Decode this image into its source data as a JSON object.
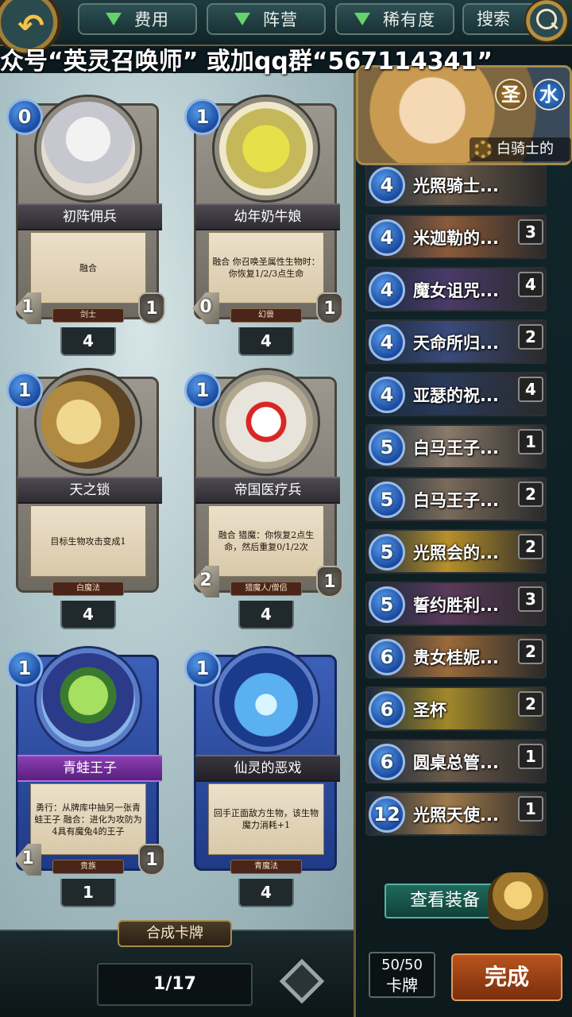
{
  "topbar": {
    "filters": [
      {
        "label": "费用"
      },
      {
        "label": "阵营"
      },
      {
        "label": "稀有度"
      }
    ],
    "search_label": "搜索"
  },
  "watermark": "众号“英灵召唤师” 或加qq群“567114341”",
  "cards": [
    {
      "name": "初阵佣兵",
      "cost": "0",
      "desc": "融合",
      "atk": "1",
      "hp": "1",
      "type": "剑士",
      "owned": "4",
      "style": "grey",
      "portrait": "pf-1"
    },
    {
      "name": "幼年奶牛娘",
      "cost": "1",
      "desc": "融合\n你召唤圣属性生物时：你恢复1/2/3点生命",
      "atk": "0",
      "hp": "1",
      "type": "幻兽",
      "owned": "4",
      "style": "grey",
      "portrait": "pf-2"
    },
    {
      "name": "天之锁",
      "cost": "1",
      "desc": "目标生物攻击变成1",
      "atk": "",
      "hp": "",
      "type": "白魔法",
      "owned": "4",
      "style": "grey",
      "portrait": "pf-3"
    },
    {
      "name": "帝国医疗兵",
      "cost": "1",
      "desc": "融合\n猎魔：你恢复2点生命，然后重复0/1/2次",
      "atk": "2",
      "hp": "1",
      "type": "猎魔人/僧侣",
      "owned": "4",
      "style": "grey",
      "portrait": "pf-4"
    },
    {
      "name": "青蛙王子",
      "cost": "1",
      "desc": "勇行：从牌库中抽另一张青蛙王子\n融合：进化为攻防为4具有魔兔4的王子",
      "atk": "1",
      "hp": "1",
      "type": "贵族",
      "owned": "1",
      "style": "blue purple",
      "portrait": "pf-5"
    },
    {
      "name": "仙灵的恶戏",
      "cost": "1",
      "desc": "回手正面敌方生物，该生物魔力消耗+1",
      "atk": "",
      "hp": "",
      "type": "青魔法",
      "owned": "4",
      "style": "blue blue2",
      "portrait": "pf-6"
    }
  ],
  "pager": {
    "merge_label": "合成卡牌",
    "page": "1/17"
  },
  "deck_hero": {
    "elements": [
      "圣",
      "水"
    ],
    "label": "白骑士的"
  },
  "deck": [
    {
      "cost": "4",
      "name": "光照骑士...",
      "count": "",
      "art": "#6a5a4a"
    },
    {
      "cost": "4",
      "name": "米迦勒的...",
      "count": "3",
      "art": "#8a5a3a"
    },
    {
      "cost": "4",
      "name": "魔女诅咒...",
      "count": "4",
      "art": "#4a3a6a"
    },
    {
      "cost": "4",
      "name": "天命所归...",
      "count": "2",
      "art": "#3a4a7a"
    },
    {
      "cost": "4",
      "name": "亚瑟的祝...",
      "count": "4",
      "art": "#2a3a5a"
    },
    {
      "cost": "5",
      "name": "白马王子...",
      "count": "1",
      "art": "#8a7a6a"
    },
    {
      "cost": "5",
      "name": "白马王子...",
      "count": "2",
      "art": "#7a6a5a"
    },
    {
      "cost": "5",
      "name": "光照会的...",
      "count": "2",
      "art": "#b8902a"
    },
    {
      "cost": "5",
      "name": "誓约胜利...",
      "count": "3",
      "art": "#5a3a5a"
    },
    {
      "cost": "6",
      "name": "贵女桂妮...",
      "count": "2",
      "art": "#9a6a3a"
    },
    {
      "cost": "6",
      "name": "圣杯",
      "count": "2",
      "art": "#a0882a"
    },
    {
      "cost": "6",
      "name": "圆桌总管...",
      "count": "1",
      "art": "#6a5a4a"
    },
    {
      "cost": "12",
      "name": "光照天使...",
      "count": "1",
      "art": "#a07a4a"
    }
  ],
  "view_equip_label": "查看装备",
  "card_count": {
    "value": "50/50",
    "label": "卡牌"
  },
  "done_label": "完成"
}
